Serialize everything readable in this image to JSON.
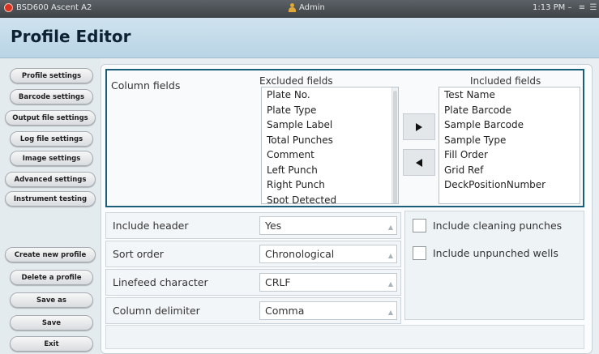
{
  "window": {
    "title": "BSD600 Ascent A2",
    "user": "Admin",
    "time": "1:13 PM"
  },
  "page_title": "Profile Editor",
  "sidebar": {
    "items": [
      {
        "label": "Profile settings"
      },
      {
        "label": "Barcode settings"
      },
      {
        "label": "Output file settings"
      },
      {
        "label": "Log file settings"
      },
      {
        "label": "Image settings"
      },
      {
        "label": "Advanced settings"
      },
      {
        "label": "Instrument testing"
      },
      {
        "label": "Create new profile"
      },
      {
        "label": "Delete a profile"
      },
      {
        "label": "Save as"
      },
      {
        "label": "Save"
      },
      {
        "label": "Exit"
      }
    ]
  },
  "column_fields": {
    "label": "Column fields",
    "excluded_header": "Excluded fields",
    "included_header": "Included fields",
    "excluded": [
      "Plate No.",
      "Plate Type",
      "Sample Label",
      "Total Punches",
      "Comment",
      "Left Punch",
      "Right Punch",
      "Spot Detected"
    ],
    "included": [
      "Test Name",
      "Plate Barcode",
      "Sample Barcode",
      "Sample Type",
      "Fill Order",
      "Grid Ref",
      "DeckPositionNumber"
    ]
  },
  "settings": [
    {
      "label": "Include header",
      "value": "Yes"
    },
    {
      "label": "Sort order",
      "value": "Chronological"
    },
    {
      "label": "Linefeed character",
      "value": "CRLF"
    },
    {
      "label": "Column delimiter",
      "value": "Comma"
    }
  ],
  "options": [
    {
      "label": "Include cleaning punches",
      "checked": false
    },
    {
      "label": "Include unpunched wells",
      "checked": false
    }
  ]
}
